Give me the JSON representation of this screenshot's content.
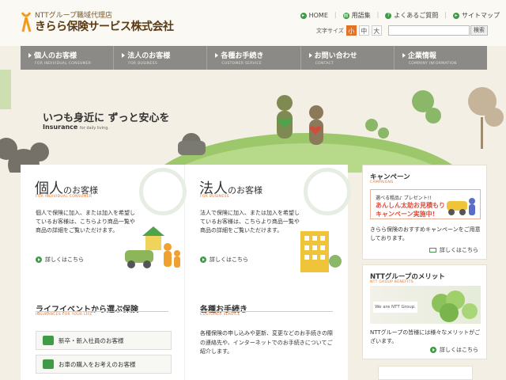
{
  "header": {
    "logo_sub": "NTTグループ職域代理店",
    "logo_main": "きらら保険サービス株式会社",
    "toplinks": [
      {
        "label": "HOME",
        "icon": "arrow-icon"
      },
      {
        "label": "用語集",
        "icon": "book-icon"
      },
      {
        "label": "よくあるご質問",
        "icon": "question-icon"
      },
      {
        "label": "サイトマップ",
        "icon": "arrow-icon"
      }
    ],
    "fontsize_label": "文字サイズ",
    "fontsize_options": [
      "小",
      "中",
      "大"
    ],
    "search_placeholder": "",
    "search_button": "検索"
  },
  "nav": [
    {
      "label": "個人のお客様",
      "en": "FOR INDIVIDUAL CONSUMER"
    },
    {
      "label": "法人のお客様",
      "en": "FOR BUSINESS"
    },
    {
      "label": "各種お手続き",
      "en": "CUSTOMER SERVICE"
    },
    {
      "label": "お問い合わせ",
      "en": "CONTACT"
    },
    {
      "label": "企業情報",
      "en": "COMPANY INFORMATION"
    }
  ],
  "hero": {
    "tagline": "いつも身近に ずっと安心を",
    "sub_bold": "Insurance",
    "sub_small": "for daily living."
  },
  "panels": {
    "individual": {
      "title_big": "個人",
      "title_small": "のお客様",
      "en": "FOR INDIVIDUAL CONSUMER",
      "desc": "個人で保険に加入、または加入を希望しているお客様は、こちらより商品一覧や商品の詳細をご覧いただけます。",
      "link": "詳しくはこちら"
    },
    "business": {
      "title_big": "法人",
      "title_small": "のお客様",
      "en": "FOR BUSINESS",
      "desc": "法人で保険に加入、または加入を希望しているお客様は、こちらより商品一覧や商品の詳細をご覧いただけます。",
      "link": "詳しくはこちら"
    }
  },
  "life_events": {
    "title": "ライフイベントから選ぶ保険",
    "en": "INSURANCES FOR YOUR LIFE",
    "items": [
      "新卒・新入社員のお客様",
      "お車の購入をお考えのお客様"
    ]
  },
  "procedures": {
    "title": "各種お手続き",
    "en": "CUSTOMER SERVICE",
    "desc": "各種保険の申し込みや更新、変更などのお手続きの際の連絡先や、インターネットでのお手続きについてご紹介します。"
  },
  "sidebar": {
    "campaign": {
      "title": "キャンペーン",
      "en": "CAMPAIGNS",
      "banner_line1": "選べる粗品♪ プレゼント!!",
      "banner_line2": "あんしん太助お見積もり",
      "banner_line3": "キャンペーン実施中!",
      "desc": "きらら保険のおすすめキャンペーンをご用意しております。",
      "link": "詳しくはこちら"
    },
    "merit": {
      "title": "NTTグループのメリット",
      "en": "NTT GROUP BENEFITS",
      "image_label": "We are NTT Group.",
      "desc": "NTTグループの皆様には様々なメリットがございます。",
      "link": "詳しくはこちら"
    }
  },
  "colors": {
    "accent": "#e4732a",
    "green": "#3f9b46",
    "nav_bg": "#8c8a86",
    "page_bg": "#f4efe4"
  }
}
